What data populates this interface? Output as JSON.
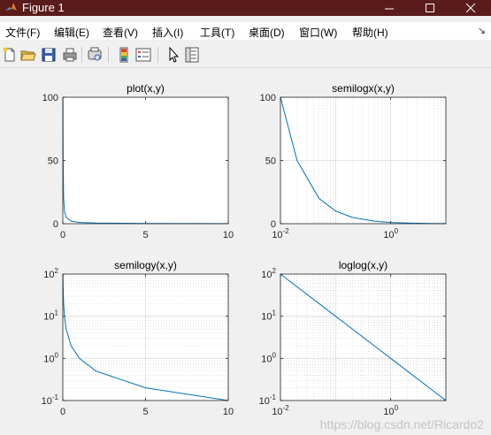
{
  "window": {
    "title": "Figure 1",
    "controls": [
      "minimize",
      "maximize",
      "close"
    ]
  },
  "menubar": {
    "items": [
      "文件(F)",
      "编辑(E)",
      "查看(V)",
      "插入(I)",
      "工具(T)",
      "桌面(D)",
      "窗口(W)",
      "帮助(H)"
    ],
    "overflow_arrow": "↘"
  },
  "toolbar": {
    "buttons": [
      "new-figure-icon",
      "open-file-icon",
      "save-icon",
      "print-icon",
      "print-preview-icon",
      "colorbar-icon",
      "legend-icon",
      "select-pointer-icon",
      "property-inspector-icon"
    ]
  },
  "chart_data": [
    {
      "type": "line",
      "title": "plot(x,y)",
      "x": [
        0.01,
        0.02,
        0.05,
        0.1,
        0.2,
        0.5,
        1,
        2,
        5,
        10
      ],
      "y": [
        100,
        50,
        20,
        10,
        5,
        2,
        1,
        0.5,
        0.2,
        0.1
      ],
      "xlim": [
        0,
        10
      ],
      "ylim": [
        0,
        100
      ],
      "xticks": [
        0,
        5,
        10
      ],
      "yticks": [
        0,
        50,
        100
      ],
      "xtick_labels": [
        "0",
        "5",
        "10"
      ],
      "ytick_labels": [
        "0",
        "50",
        "100"
      ],
      "xscale": "linear",
      "yscale": "linear",
      "grid": false,
      "color": "#0072bd"
    },
    {
      "type": "line",
      "title": "semilogx(x,y)",
      "x": [
        0.01,
        0.02,
        0.05,
        0.1,
        0.2,
        0.5,
        1,
        2,
        5,
        10
      ],
      "y": [
        100,
        50,
        20,
        10,
        5,
        2,
        1,
        0.5,
        0.2,
        0.1
      ],
      "xlim": [
        0.01,
        10
      ],
      "ylim": [
        0,
        100
      ],
      "xticks": [
        0.01,
        1
      ],
      "yticks": [
        0,
        50,
        100
      ],
      "xtick_labels": [
        "10^-2",
        "10^0"
      ],
      "ytick_labels": [
        "0",
        "50",
        "100"
      ],
      "xscale": "log",
      "yscale": "linear",
      "grid": true,
      "color": "#0072bd"
    },
    {
      "type": "line",
      "title": "semilogy(x,y)",
      "x": [
        0.01,
        0.02,
        0.05,
        0.1,
        0.2,
        0.5,
        1,
        2,
        5,
        10
      ],
      "y": [
        100,
        50,
        20,
        10,
        5,
        2,
        1,
        0.5,
        0.2,
        0.1
      ],
      "xlim": [
        0,
        10
      ],
      "ylim": [
        0.1,
        100
      ],
      "xticks": [
        0,
        5,
        10
      ],
      "yticks": [
        0.1,
        1,
        10,
        100
      ],
      "xtick_labels": [
        "0",
        "5",
        "10"
      ],
      "ytick_labels": [
        "10^-1",
        "10^0",
        "10^1",
        "10^2"
      ],
      "xscale": "linear",
      "yscale": "log",
      "grid": true,
      "color": "#0072bd"
    },
    {
      "type": "line",
      "title": "loglog(x,y)",
      "x": [
        0.01,
        0.02,
        0.05,
        0.1,
        0.2,
        0.5,
        1,
        2,
        5,
        10
      ],
      "y": [
        100,
        50,
        20,
        10,
        5,
        2,
        1,
        0.5,
        0.2,
        0.1
      ],
      "xlim": [
        0.01,
        10
      ],
      "ylim": [
        0.1,
        100
      ],
      "xticks": [
        0.01,
        1
      ],
      "yticks": [
        0.1,
        1,
        10,
        100
      ],
      "xtick_labels": [
        "10^-2",
        "10^0"
      ],
      "ytick_labels": [
        "10^-1",
        "10^0",
        "10^1",
        "10^2"
      ],
      "xscale": "log",
      "yscale": "log",
      "grid": true,
      "color": "#0072bd"
    }
  ],
  "watermark": "https://blog.csdn.net/Ricardo2"
}
